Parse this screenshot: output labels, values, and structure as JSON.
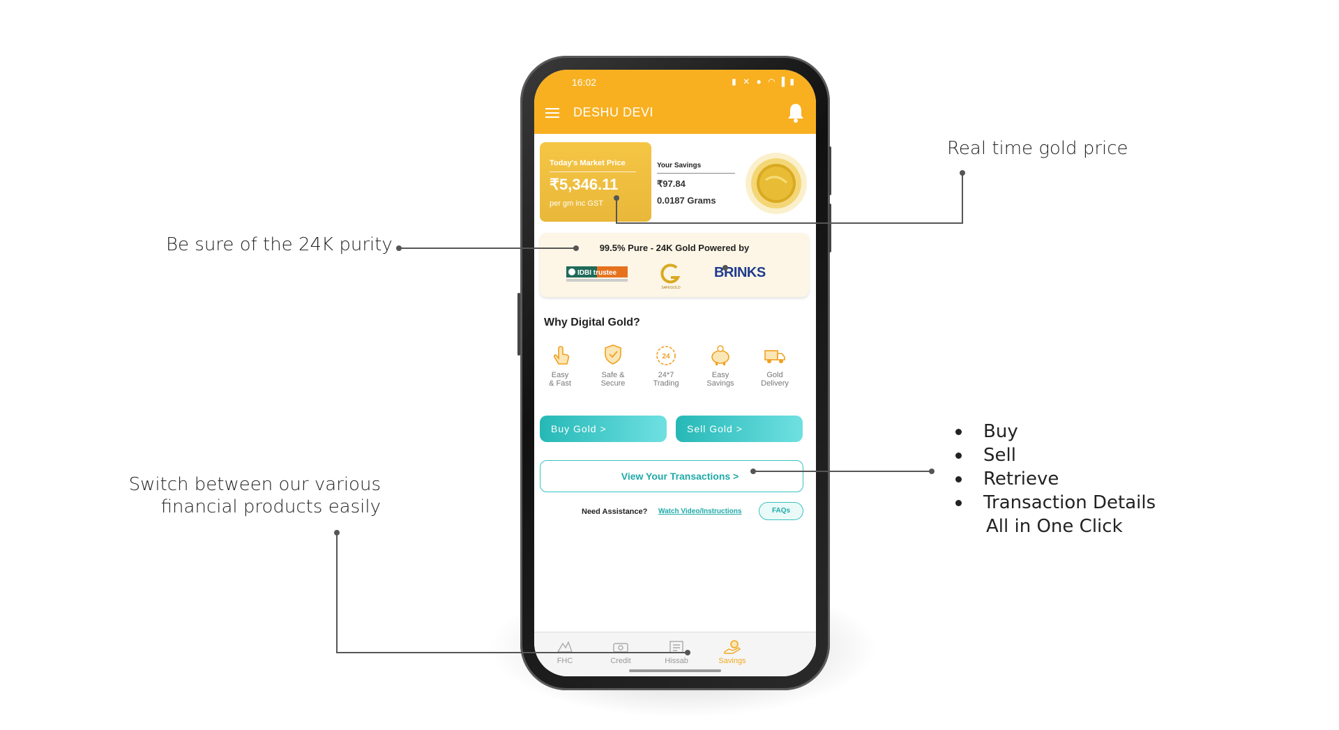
{
  "annotations": {
    "gold_price": "Real time gold price",
    "purity": "Be sure of the 24K purity",
    "switch_line1": "Switch between our various",
    "switch_line2": "financial products easily",
    "bullets": [
      "Buy",
      "Sell",
      "Retrieve",
      "Transaction Details"
    ],
    "bullets_tail": "All in One Click"
  },
  "status_bar": {
    "time": "16:02"
  },
  "header": {
    "user_name": "DESHU DEVI"
  },
  "market": {
    "label": "Today's Market Price",
    "price": "₹5,346.11",
    "unit": "per gm inc GST"
  },
  "savings": {
    "label": "Your Savings",
    "amount": "₹97.84",
    "grams": "0.0187 Grams"
  },
  "purity_card": {
    "title": "99.5% Pure - 24K Gold Powered by",
    "logos": {
      "idbi": "IDBI trustee",
      "safegold": "SAFEGOLD",
      "brinks": "BRINKS"
    }
  },
  "why": {
    "title": "Why Digital Gold?",
    "features": [
      {
        "label": "Easy\n& Fast",
        "icon": "tap-icon"
      },
      {
        "label": "Safe &\nSecure",
        "icon": "shield-hand-icon"
      },
      {
        "label": "24*7\nTrading",
        "icon": "clock-24-icon"
      },
      {
        "label": "Easy\nSavings",
        "icon": "piggy-bank-icon"
      },
      {
        "label": "Gold\nDelivery",
        "icon": "truck-icon"
      }
    ]
  },
  "actions": {
    "buy": "Buy Gold >",
    "sell": "Sell Gold >",
    "transactions": "View Your Transactions >"
  },
  "assistance": {
    "label": "Need Assistance?",
    "watch": "Watch Video/Instructions",
    "faqs": "FAQs"
  },
  "nav": {
    "items": [
      "FHC",
      "Credit",
      "Hissab",
      "Savings"
    ],
    "active": "Savings"
  },
  "colors": {
    "header": "#f8b021",
    "teal": "#26b8b6",
    "gold_card": "#f0c040"
  }
}
